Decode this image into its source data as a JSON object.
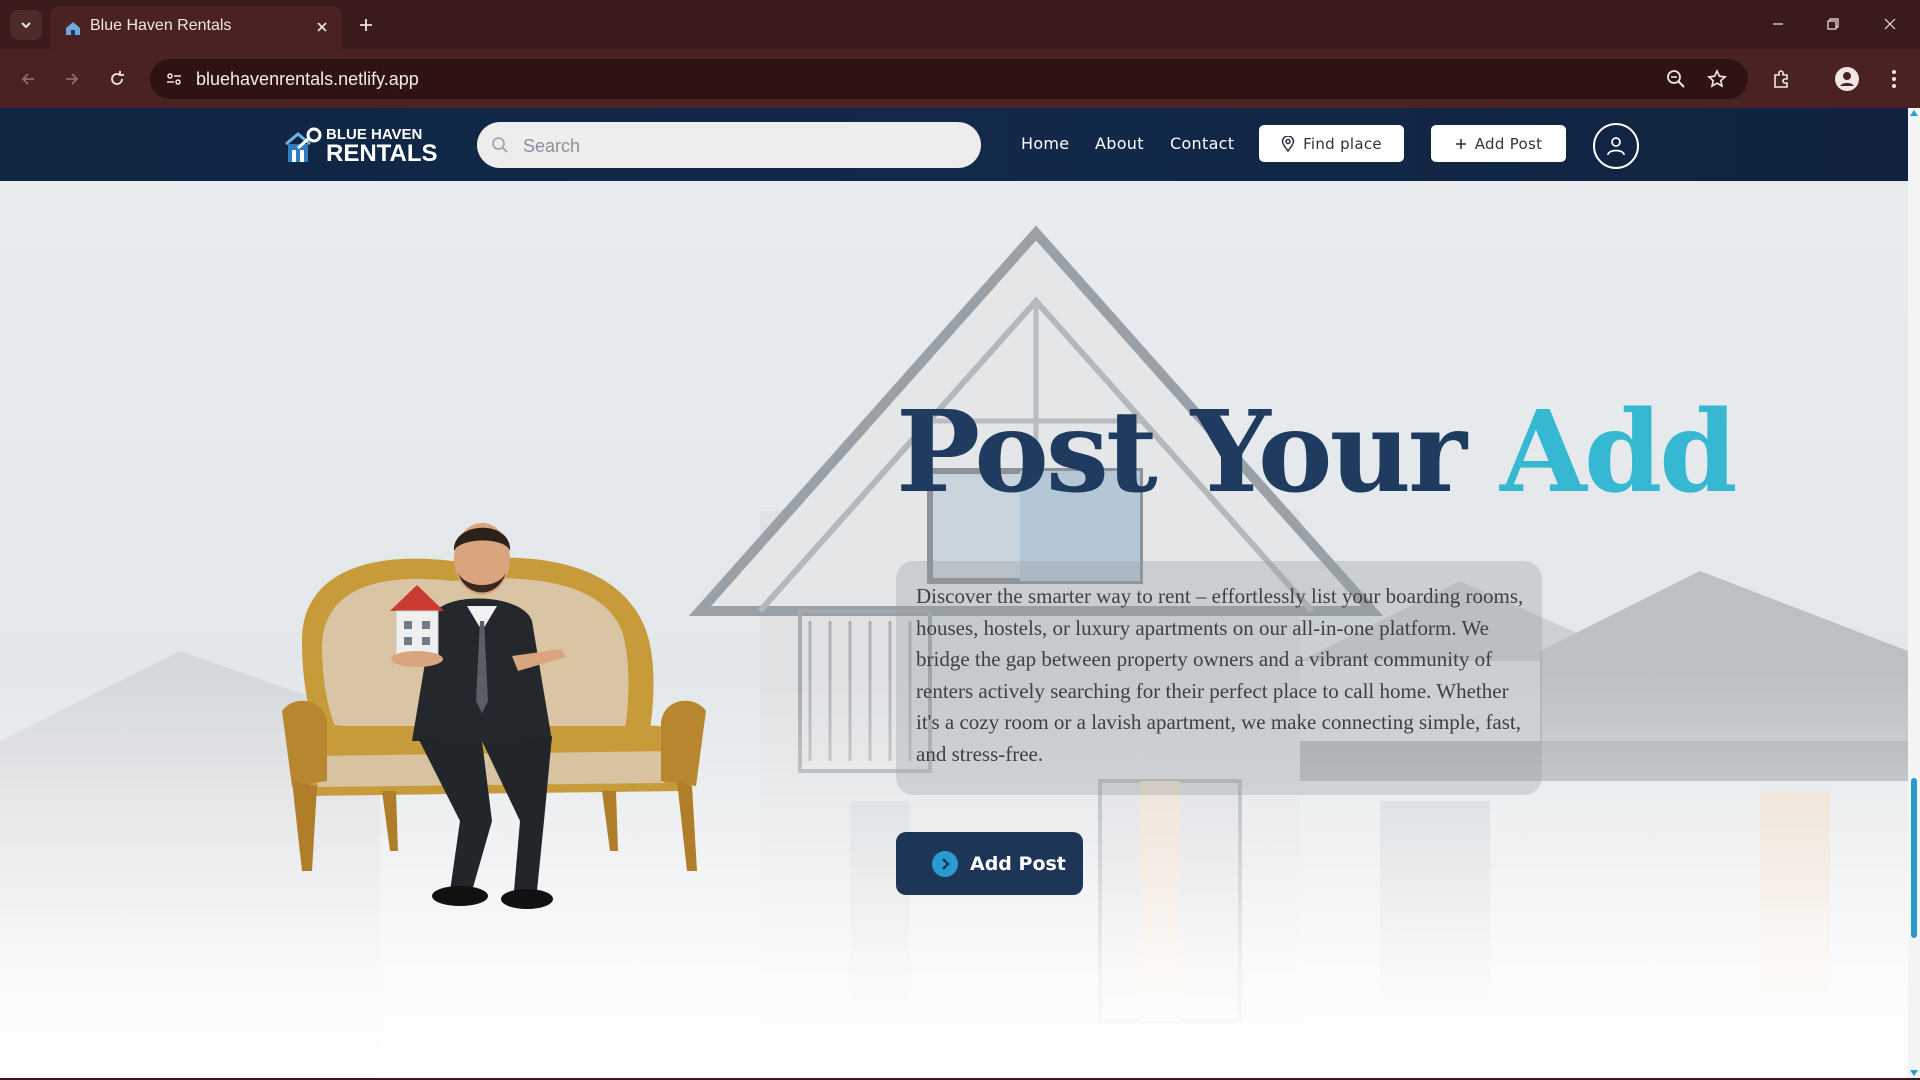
{
  "browser": {
    "tab_title": "Blue Haven Rentals",
    "url": "bluehavenrentals.netlify.app",
    "icons": [
      "tab-search-icon",
      "favicon",
      "close-icon",
      "plus-icon",
      "minimize-icon",
      "restore-icon",
      "close-window-icon",
      "back-icon",
      "forward-icon",
      "reload-icon",
      "site-info-icon",
      "zoom-icon",
      "star-icon",
      "extensions-icon",
      "profile-icon",
      "menu-icon"
    ]
  },
  "site": {
    "logo": {
      "line1": "BLUE HAVEN",
      "line2": "RENTALS"
    },
    "search": {
      "placeholder": "Search"
    },
    "nav": {
      "home": "Home",
      "about": "About",
      "contact": "Contact"
    },
    "find_place_label": "Find place",
    "add_post_label": "Add Post",
    "colors": {
      "navbar": "#13294a",
      "accent": "#36b8d2",
      "heading": "#1f3b60",
      "cta": "#1d3557"
    }
  },
  "hero": {
    "heading_main": "Post Your ",
    "heading_accent": "Add",
    "description": "Discover the smarter way to rent – effortlessly list your boarding rooms, houses, hostels, or luxury apartments on our all-in-one platform. We bridge the gap between property owners and a vibrant community of renters actively searching for their perfect place to call home. Whether it's a cozy room or a lavish apartment, we make connecting simple, fast, and stress-free.",
    "cta_label": "Add Post"
  }
}
